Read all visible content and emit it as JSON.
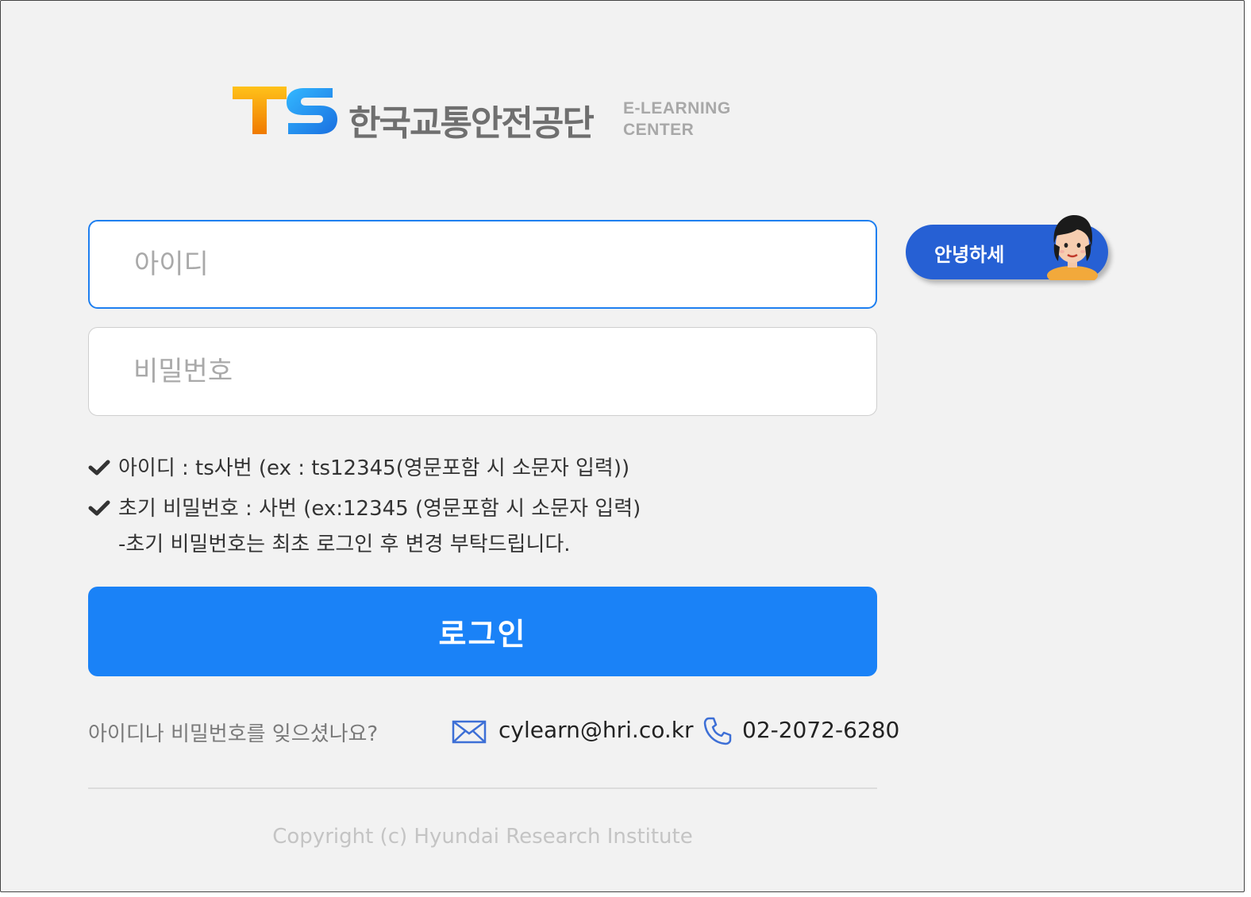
{
  "logo": {
    "mark": "TS",
    "org_name": "한국교통안전공단",
    "sub_line1": "E-LEARNING",
    "sub_line2": "CENTER"
  },
  "login_form": {
    "id_placeholder": "아이디",
    "id_value": "",
    "password_placeholder": "비밀번호",
    "password_value": "",
    "submit_label": "로그인"
  },
  "greeting": {
    "label": "안녕하세"
  },
  "notes": {
    "id_hint": "아이디 : ts사번 (ex : ts12345(영문포함 시 소문자 입력))",
    "password_hint": "초기 비밀번호 : 사번 (ex:12345 (영문포함 시 소문자 입력)",
    "password_change_hint": "-초기 비밀번호는 최초 로그인 후 변경 부탁드립니다."
  },
  "contact": {
    "forgot_text": "아이디나 비밀번호를 잊으셨나요?",
    "email": "cylearn@hri.co.kr",
    "phone": "02-2072-6280"
  },
  "footer": {
    "copyright": "Copyright (c) Hyundai Research Institute"
  },
  "colors": {
    "accent": "#1a82f7",
    "greeting_bg": "#2660d4",
    "focus_border": "#1e7ff0"
  },
  "icons": [
    "check-icon",
    "mail-icon",
    "phone-icon"
  ]
}
